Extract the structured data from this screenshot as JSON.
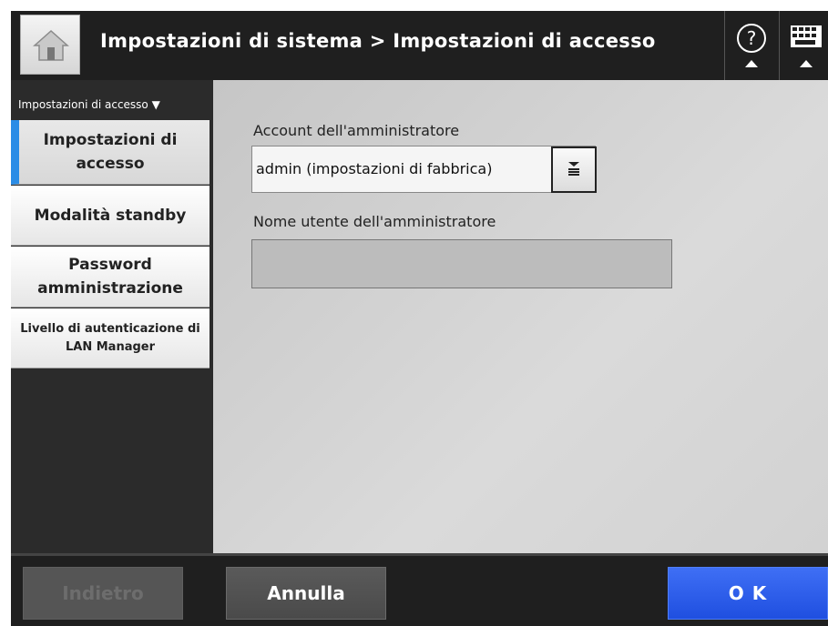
{
  "header": {
    "title": "Impostazioni di sistema > Impostazioni di accesso",
    "home_icon": "home-icon",
    "help_icon": "help-icon",
    "keyboard_icon": "keyboard-icon"
  },
  "sidebar": {
    "header": "Impostazioni di accesso ▼",
    "items": [
      {
        "label": "Impostazioni di accesso",
        "active": true
      },
      {
        "label": "Modalità standby",
        "active": false
      },
      {
        "label": "Password amministrazione",
        "active": false
      },
      {
        "label": "Livello di autenticazione di LAN Manager",
        "active": false
      }
    ]
  },
  "main": {
    "admin_account_label": "Account dell'amministratore",
    "admin_account_value": "admin  (impostazioni di fabbrica)",
    "admin_username_label": "Nome utente dell'amministratore",
    "admin_username_value": ""
  },
  "footer": {
    "back_label": "Indietro",
    "cancel_label": "Annulla",
    "ok_label": "O K"
  },
  "colors": {
    "accent": "#2a8ce6",
    "ok_button": "#2a58ea",
    "header_bg": "#1f1f1f"
  }
}
